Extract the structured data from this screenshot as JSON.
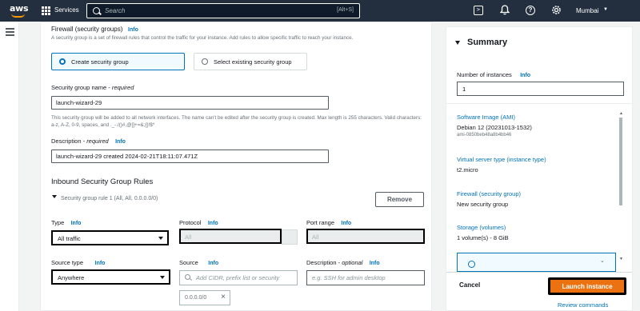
{
  "topnav": {
    "logo": "aws",
    "services_label": "Services",
    "search_placeholder": "Search",
    "search_shortcut": "[Alt+S]",
    "region": "Mumbai"
  },
  "firewall": {
    "title": "Firewall (security groups)",
    "info": "Info",
    "description": "A security group is a set of firewall rules that control the traffic for your instance. Add rules to allow specific traffic to reach your instance.",
    "create_option": "Create security group",
    "existing_option": "Select existing security group",
    "sg_name_label": "Security group name",
    "required_tag": "required",
    "sg_name_value": "launch-wizard-29",
    "sg_name_hint": "This security group will be added to all network interfaces. The name can't be edited after the security group is created. Max length is 255 characters. Valid characters: a-z, A-Z, 0-9, spaces, and ._-:/()#,@[]+=&;{}!$*",
    "desc_label": "Description",
    "desc_value": "launch-wizard-29 created 2024-02-21T18:11:07.471Z"
  },
  "inbound": {
    "title": "Inbound Security Group Rules",
    "rule_label": "Security group rule 1 (All, All, 0.0.0.0/0)",
    "remove_label": "Remove",
    "type_label": "Type",
    "type_value": "All traffic",
    "protocol_label": "Protocol",
    "protocol_value": "All",
    "port_label": "Port range",
    "port_value": "All",
    "source_type_label": "Source type",
    "source_type_value": "Anywhere",
    "source_label": "Source",
    "source_placeholder": "Add CIDR, prefix list or security",
    "desc_label": "Description",
    "optional_tag": "optional",
    "desc_placeholder": "e.g. SSH for admin desktop",
    "cidr_token": "0.0.0.0/0",
    "info": "Info"
  },
  "summary": {
    "title": "Summary",
    "instances_label": "Number of instances",
    "info": "Info",
    "instances_value": "1",
    "ami_label": "Software Image (AMI)",
    "ami_value": "Debian 12 (20231013-1532)",
    "ami_id": "ami-0850beb48a8b4bb46",
    "instance_type_label": "Virtual server type (instance type)",
    "instance_type_value": "t2.micro",
    "firewall_label": "Firewall (security group)",
    "firewall_value": "New security group",
    "storage_label": "Storage (volumes)",
    "storage_value": "1 volume(s) - 8 GiB",
    "cancel_label": "Cancel",
    "launch_label": "Launch instance",
    "review_label": "Review commands"
  }
}
